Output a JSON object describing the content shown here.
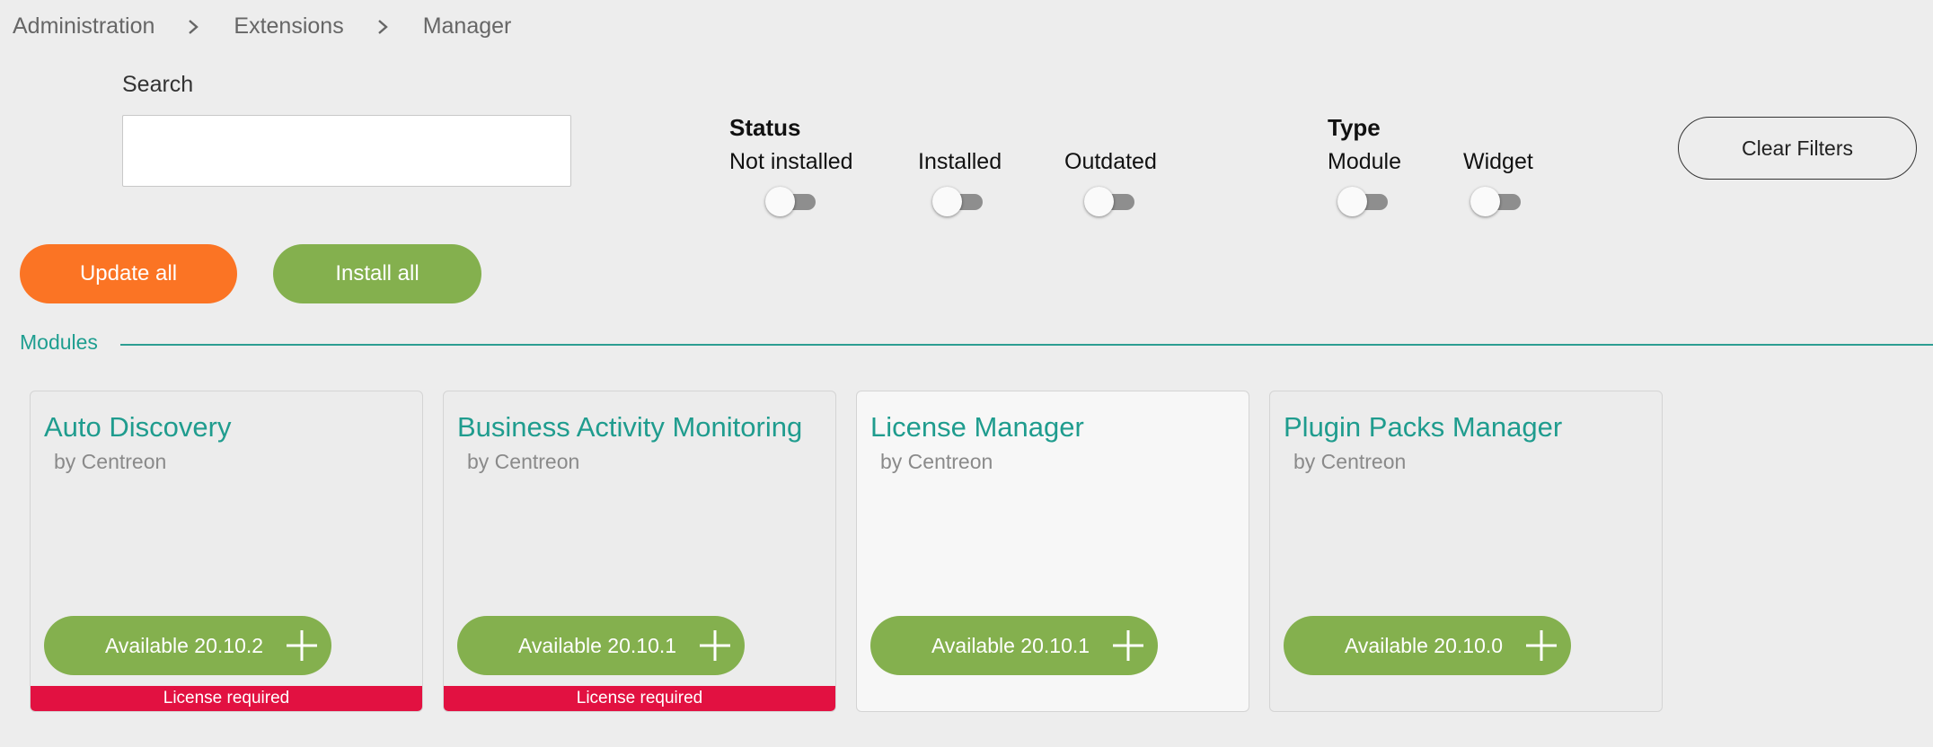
{
  "breadcrumb": {
    "items": [
      "Administration",
      "Extensions",
      "Manager"
    ]
  },
  "search": {
    "label": "Search",
    "value": "",
    "placeholder": ""
  },
  "filters": {
    "status": {
      "title": "Status",
      "options": [
        {
          "label": "Not installed",
          "on": false
        },
        {
          "label": "Installed",
          "on": false
        },
        {
          "label": "Outdated",
          "on": false
        }
      ]
    },
    "type": {
      "title": "Type",
      "options": [
        {
          "label": "Module",
          "on": false
        },
        {
          "label": "Widget",
          "on": false
        }
      ]
    },
    "clear_label": "Clear Filters"
  },
  "actions": {
    "update_all": "Update all",
    "install_all": "Install all"
  },
  "section": {
    "title": "Modules"
  },
  "modules": [
    {
      "name": "Auto Discovery",
      "author": "by Centreon",
      "button": "Available 20.10.2",
      "license": "License required"
    },
    {
      "name": "Business Activity Monitoring",
      "author": "by Centreon",
      "button": "Available 20.10.1",
      "license": "License required"
    },
    {
      "name": "License Manager",
      "author": "by Centreon",
      "button": "Available 20.10.1",
      "license": ""
    },
    {
      "name": "Plugin Packs Manager",
      "author": "by Centreon",
      "button": "Available 20.10.0",
      "license": ""
    }
  ],
  "colors": {
    "accent": "#1f9c8e",
    "update_button": "#fb7424",
    "install_button": "#84b04e",
    "license_bar": "#e21141"
  }
}
